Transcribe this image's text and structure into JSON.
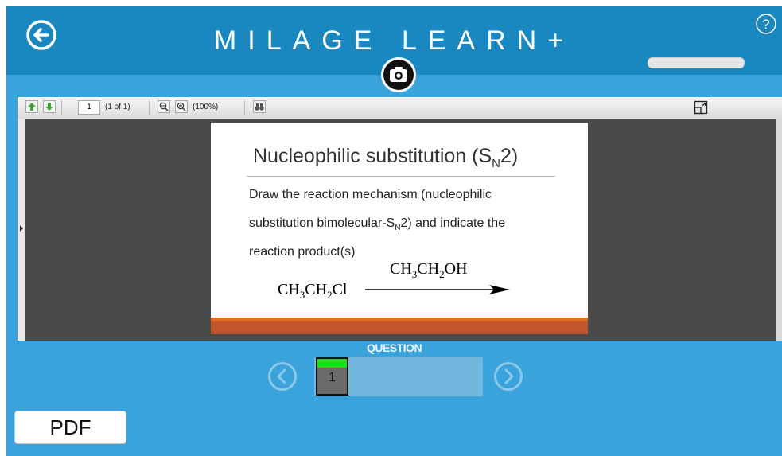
{
  "header": {
    "title": "MILAGE LEARN+"
  },
  "viewer": {
    "toolbar": {
      "page_value": "1",
      "page_count": "(1 of 1)",
      "zoom_level": "(100%)"
    },
    "slide": {
      "title": "Nucleophilic substitution (S",
      "title_sub": "N",
      "title_end": "2)",
      "line1": "Draw the reaction mechanism (nucleophilic",
      "line2_a": "substitution bimolecular-S",
      "line2_sub": "N",
      "line2_b": "2) and indicate the",
      "line3": "reaction product(s)",
      "reagent": [
        "CH",
        "3",
        "CH",
        "2",
        "OH"
      ],
      "reactant": [
        "CH",
        "3",
        "CH",
        "2",
        "Cl"
      ]
    }
  },
  "question_nav": {
    "label": "QUESTION",
    "items": [
      {
        "number": "1"
      }
    ]
  },
  "footer": {
    "pdf_label": "PDF"
  },
  "colors": {
    "header": "#1a88c0",
    "background": "#3aa3dc",
    "accent_green": "#1de01d",
    "slide_bar": "#c1552b"
  }
}
